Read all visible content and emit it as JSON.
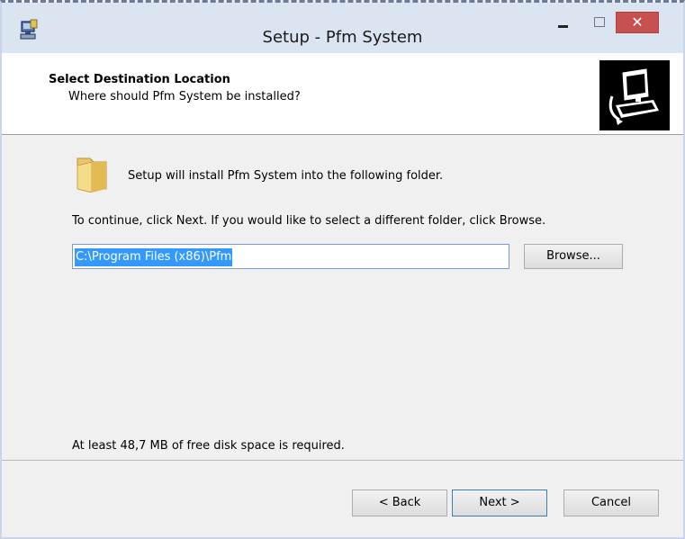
{
  "window": {
    "title": "Setup - Pfm System",
    "close_glyph": "✕"
  },
  "header": {
    "title": "Select Destination Location",
    "subtitle": "Where should Pfm System be installed?"
  },
  "content": {
    "install_message": "Setup will install Pfm System into the following folder.",
    "continue_message": "To continue, click Next. If you would like to select a different folder, click Browse.",
    "install_path": "C:\\Program Files (x86)\\Pfm",
    "browse_label": "Browse...",
    "disk_space_message": "At least 48,7 MB of free disk space is required."
  },
  "footer": {
    "back_label": "< Back",
    "next_label": "Next >",
    "cancel_label": "Cancel"
  },
  "icons": {
    "app": "setup-app-icon",
    "folder": "folder-icon",
    "header_image": "computer-install-icon",
    "minimize": "minimize-icon",
    "maximize": "maximize-icon",
    "close": "close-icon"
  },
  "colors": {
    "titlebar": "#dbe4f1",
    "close_button": "#c75050",
    "selection": "#3399ff",
    "dialog_background": "#f0f0f0"
  }
}
